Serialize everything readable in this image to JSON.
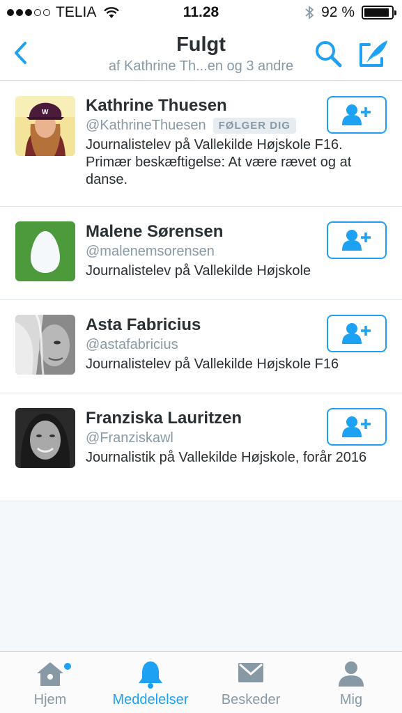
{
  "status_bar": {
    "carrier": "TELIA",
    "time": "11.28",
    "battery_percent": "92 %",
    "battery_level": 0.92,
    "signal_bars": 3,
    "signal_total": 5
  },
  "nav": {
    "title": "Fulgt",
    "subtitle": "af Kathrine Th...en og 3 andre",
    "accent": "#1da1f2"
  },
  "users": [
    {
      "name": "Kathrine Thuesen",
      "handle": "@KathrineThuesen",
      "badge": "FØLGER DIG",
      "bio": "Journalistelev på Vallekilde Højskole F16. Primær beskæftigelse: At være rævet og at danse.",
      "avatar": "photo-woman-cap"
    },
    {
      "name": "Malene Sørensen",
      "handle": "@malenemsorensen",
      "badge": "",
      "bio": "Journalistelev på Vallekilde Højskole",
      "avatar": "egg-default"
    },
    {
      "name": "Asta Fabricius",
      "handle": "@astafabricius",
      "badge": "",
      "bio": "Journalistelev på Vallekilde Højskole F16",
      "avatar": "photo-bw-hair"
    },
    {
      "name": "Franziska Lauritzen",
      "handle": "@Franziskawl",
      "badge": "",
      "bio": "Journalistik på Vallekilde Højskole, forår 2016",
      "avatar": "photo-bw-smile"
    }
  ],
  "tabs": [
    {
      "label": "Hjem",
      "icon": "home-icon"
    },
    {
      "label": "Meddelelser",
      "icon": "bell-icon"
    },
    {
      "label": "Beskeder",
      "icon": "envelope-icon"
    },
    {
      "label": "Mig",
      "icon": "person-icon"
    }
  ]
}
